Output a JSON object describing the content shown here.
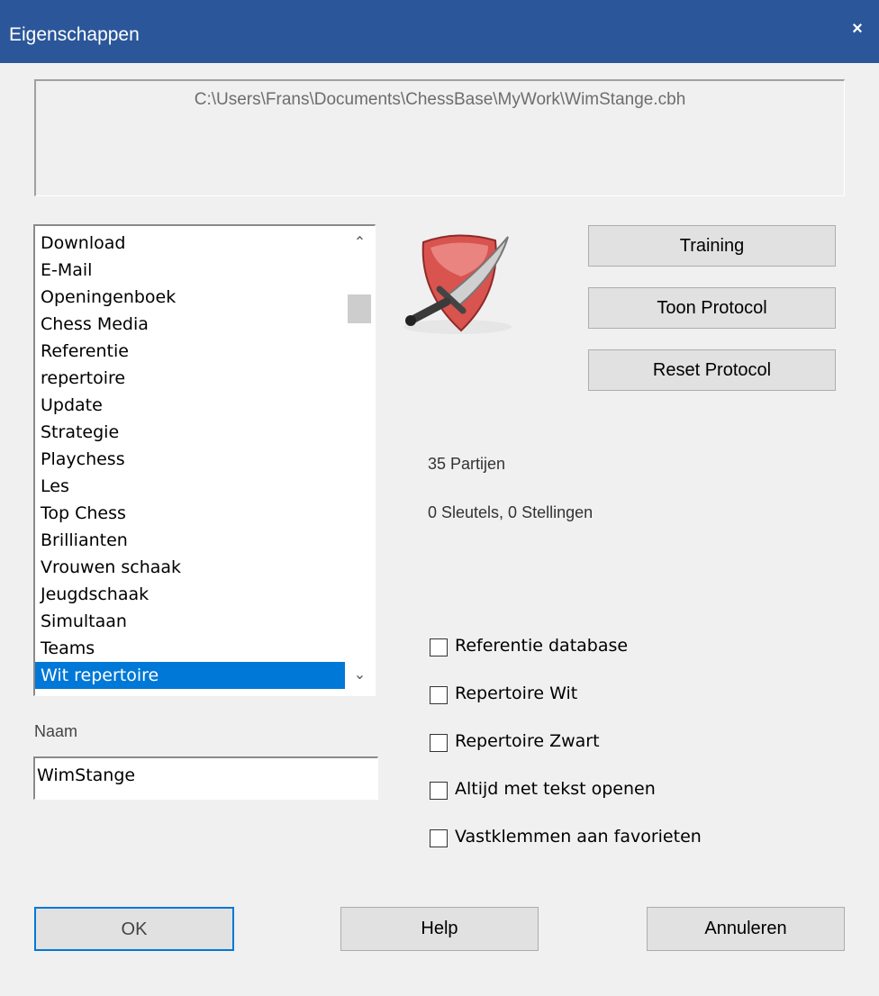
{
  "window": {
    "title": "Eigenschappen",
    "close_glyph": "×"
  },
  "path": "C:\\Users\\Frans\\Documents\\ChessBase\\MyWork\\WimStange.cbh",
  "list": {
    "items": [
      "Download",
      "E-Mail",
      "Openingenboek",
      "Chess Media",
      "Referentie",
      "repertoire",
      "Update",
      "Strategie",
      "Playchess",
      "Les",
      "Top Chess",
      "Brillianten",
      "Vrouwen schaak",
      "Jeugdschaak",
      "Simultaan",
      "Teams",
      "Wit repertoire"
    ],
    "selected": "Wit repertoire",
    "scroll_up": "⌃",
    "scroll_down": "⌄"
  },
  "icon": {
    "name": "shield-sword-icon",
    "colors": {
      "shield": "#d9534f",
      "blade": "#c8c8c8"
    }
  },
  "buttons": {
    "training": "Training",
    "show_protocol": "Toon Protocol",
    "reset_protocol": "Reset Protocol",
    "ok": "OK",
    "help": "Help",
    "cancel": "Annuleren"
  },
  "stats": {
    "games": "35 Partijen",
    "keys": "0 Sleutels, 0 Stellingen"
  },
  "name": {
    "label": "Naam",
    "value": "WimStange"
  },
  "options": [
    {
      "label": "Referentie database",
      "checked": false
    },
    {
      "label": "Repertoire Wit",
      "checked": false
    },
    {
      "label": "Repertoire Zwart",
      "checked": false
    },
    {
      "label": "Altijd met tekst openen",
      "checked": false
    },
    {
      "label": "Vastklemmen aan favorieten",
      "checked": false
    }
  ],
  "colors": {
    "titlebar": "#2b579a",
    "selection": "#0078d7",
    "ok_border": "#0078d7"
  }
}
